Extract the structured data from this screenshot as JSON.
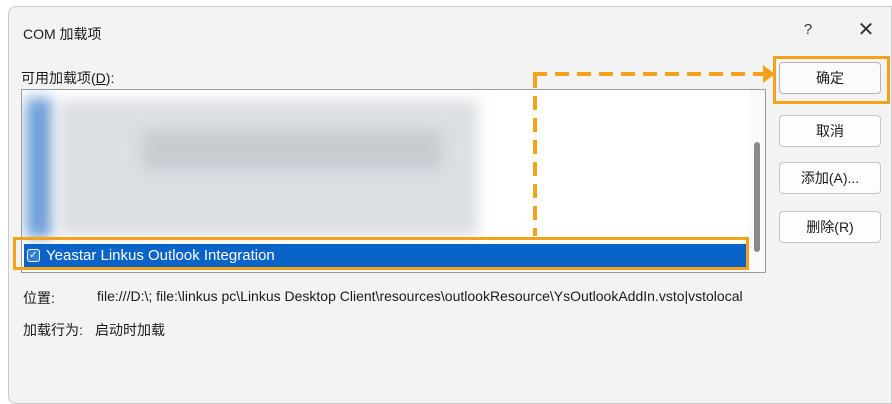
{
  "dialog": {
    "title": "COM 加载项",
    "help_label": "?",
    "close_label": "✕"
  },
  "list": {
    "label_prefix": "可用加载项(",
    "label_key": "D",
    "label_suffix": "):",
    "items": [
      {
        "label": "Yeastar Linkus Outlook Integration",
        "checked": true,
        "selected": true
      }
    ]
  },
  "buttons": {
    "ok": "确定",
    "cancel": "取消",
    "add": "添加(A)...",
    "remove": "删除(R)"
  },
  "details": {
    "location_label": "位置:",
    "location_value": "file:///D:\\; file:\\linkus pc\\Linkus Desktop Client\\resources\\outlookResource\\YsOutlookAddIn.vsto|vstolocal",
    "load_behavior_label": "加载行为:",
    "load_behavior_value": "启动时加载"
  },
  "colors": {
    "accent": "#f5a21b",
    "selection": "#0a64c8"
  }
}
